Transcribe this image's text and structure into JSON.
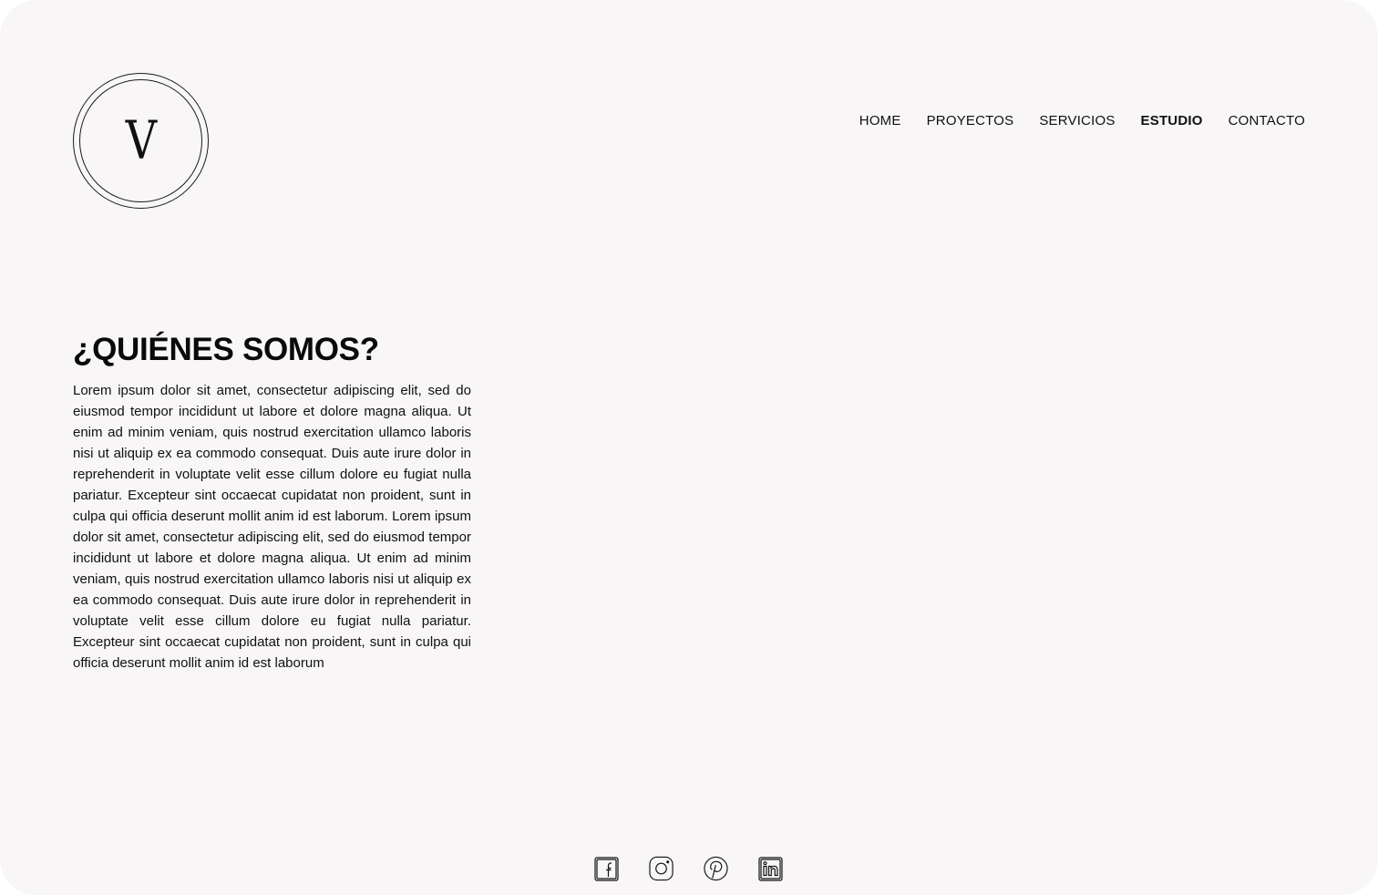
{
  "logo": {
    "letter": "V"
  },
  "nav": {
    "items": [
      {
        "label": "HOME",
        "active": false
      },
      {
        "label": "PROYECTOS",
        "active": false
      },
      {
        "label": "SERVICIOS",
        "active": false
      },
      {
        "label": "ESTUDIO",
        "active": true
      },
      {
        "label": "CONTACTO",
        "active": false
      }
    ]
  },
  "about": {
    "title": "¿QUIÉNES SOMOS?",
    "body": "Lorem ipsum dolor sit amet, consectetur adipiscing elit, sed do eiusmod tempor incididunt ut labore et dolore magna aliqua. Ut enim ad minim veniam, quis nostrud exercitation ullamco laboris nisi ut aliquip ex ea commodo consequat. Duis aute irure dolor in reprehenderit in voluptate velit esse cillum dolore eu fugiat nulla pariatur. Excepteur sint occaecat cupidatat non proident, sunt in culpa qui officia deserunt mollit anim id est laborum. Lorem ipsum dolor sit amet, consectetur adipiscing elit, sed do eiusmod tempor incididunt ut labore et dolore magna aliqua. Ut enim ad minim veniam, quis nostrud exercitation ullamco laboris nisi ut aliquip ex ea commodo consequat. Duis aute irure dolor in reprehenderit in voluptate velit esse cillum dolore eu fugiat nulla pariatur. Excepteur sint occaecat cupidatat non proident, sunt in culpa qui officia deserunt mollit anim id est laborum"
  },
  "social": {
    "icons": [
      "facebook-icon",
      "instagram-icon",
      "pinterest-icon",
      "linkedin-icon"
    ]
  },
  "colors": {
    "background": "#f8f6f7",
    "text": "#111111"
  }
}
